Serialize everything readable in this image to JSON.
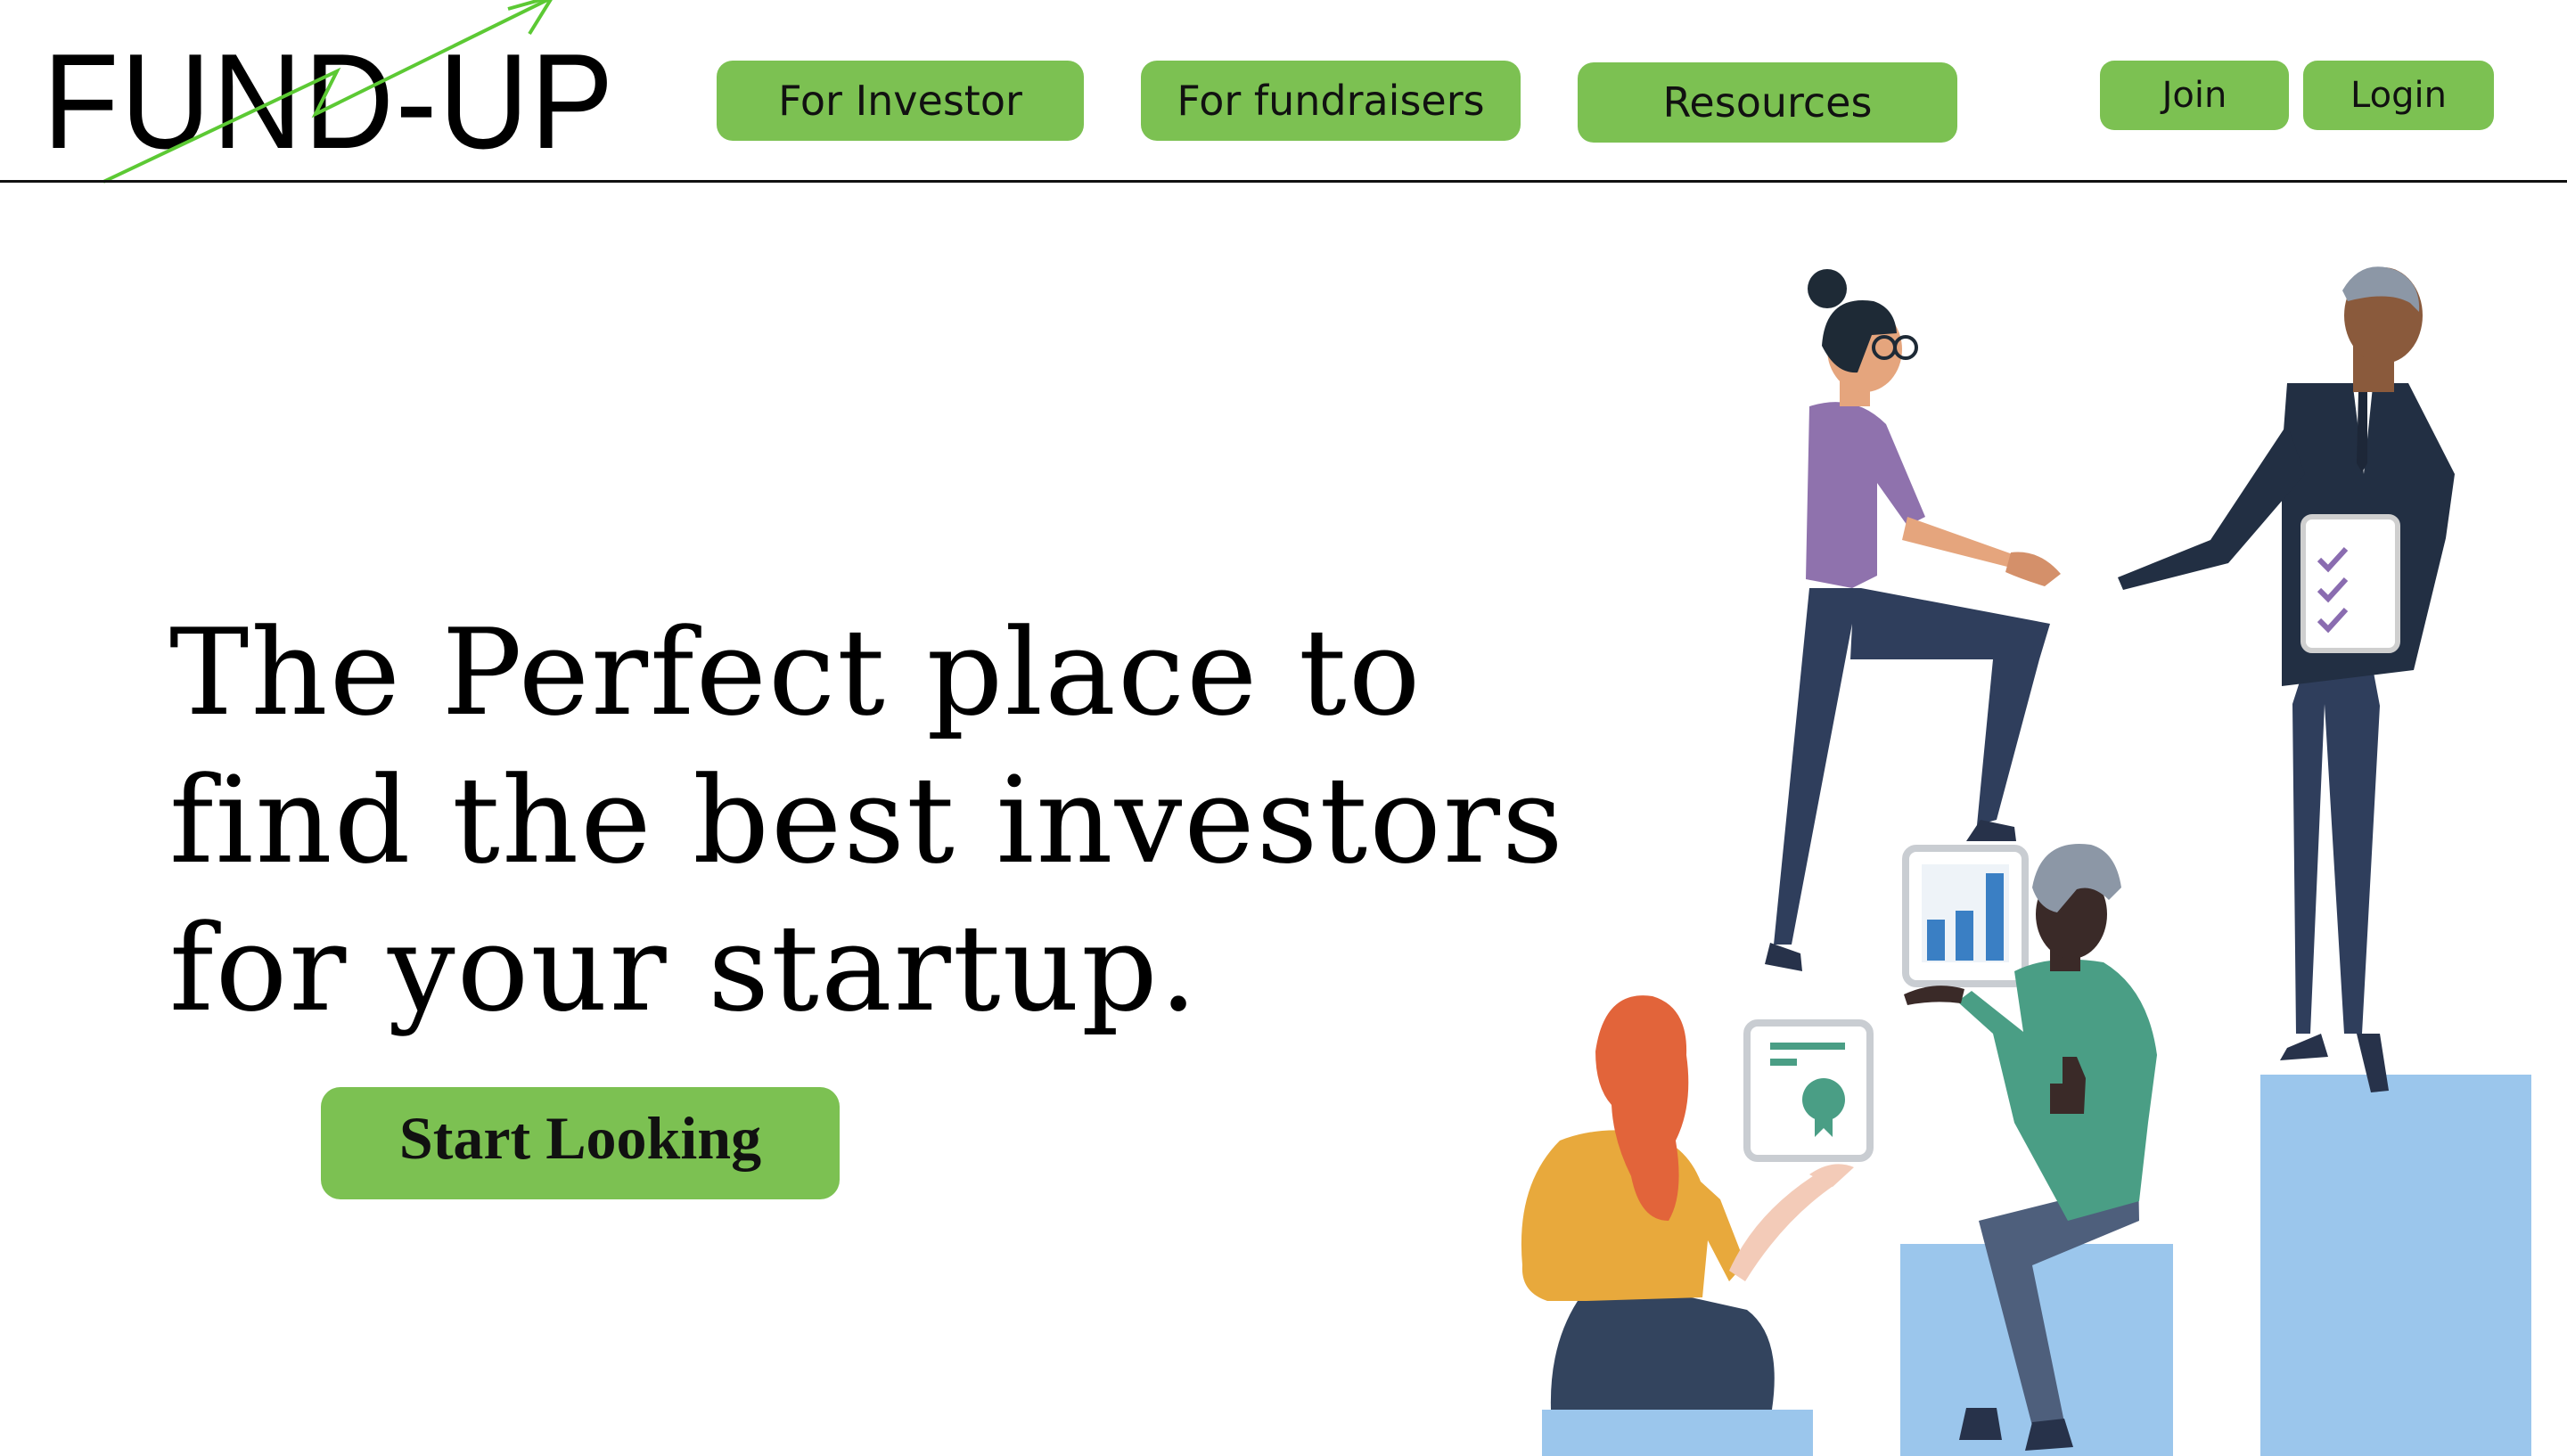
{
  "header": {
    "logo_text": "FUND-UP",
    "nav": [
      {
        "label": "For Investor"
      },
      {
        "label": "For fundraisers"
      },
      {
        "label": "Resources"
      }
    ],
    "join_label": "Join",
    "login_label": "Login"
  },
  "hero": {
    "title_lines": [
      "The Perfect place to",
      "find the best investors",
      "for your startup."
    ],
    "cta_label": "Start Looking"
  },
  "colors": {
    "accent_green": "#7cc152",
    "logo_arrow": "#5cc934",
    "pedestal_blue": "#9bc6ec"
  },
  "illustration": {
    "icons": [
      "handshake-people-icon",
      "bar-chart-card-icon",
      "certificate-card-icon",
      "checklist-clipboard-icon"
    ]
  }
}
